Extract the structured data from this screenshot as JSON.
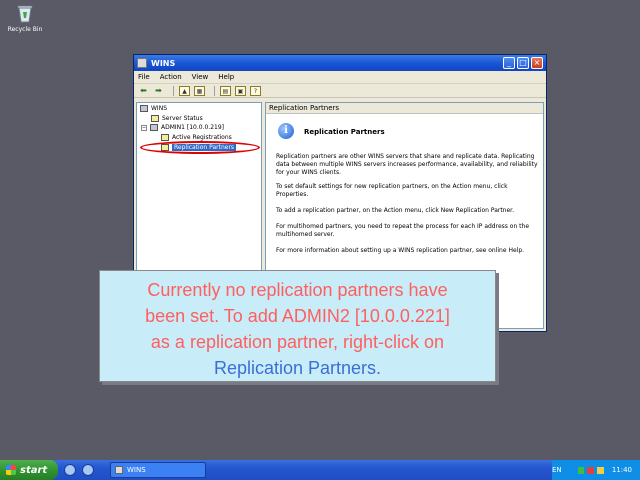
{
  "desktop": {
    "recycle_bin_label": "Recycle Bin"
  },
  "window": {
    "title": "WINS",
    "menu": [
      "File",
      "Action",
      "View",
      "Help"
    ],
    "tree": {
      "root": "WINS",
      "server_status": "Server Status",
      "server": "ADMIN1 [10.0.0.219]",
      "active_registrations": "Active Registrations",
      "replication_partners": "Replication Partners"
    },
    "content": {
      "header": "Replication Partners",
      "title": "Replication Partners",
      "paragraphs": [
        "Replication partners are other WINS servers that share and replicate data. Replicating data between multiple WINS servers increases performance, availability, and reliability for your WINS clients.",
        "To set default settings for new replication partners, on the Action menu, click Properties.",
        "To add a replication partner, on the Action menu, click New Replication Partner.",
        "For multihomed partners, you need to repeat the process for each IP address on the multihomed server.",
        "For more information about setting up a WINS replication partner, see online Help."
      ]
    }
  },
  "caption": {
    "line1": "Currently no replication partners have",
    "line2": "been set. To add ADMIN2 [10.0.0.221]",
    "line3": "as a replication partner, right-click on",
    "line4": "Replication Partners."
  },
  "taskbar": {
    "start_label": "start",
    "task_label": "WINS",
    "lang": "EN",
    "clock": "11:40"
  },
  "colors": {
    "caption_text": "#ff5f5f",
    "caption_highlight": "#3a6fd6",
    "caption_bg": "#c8ecf8",
    "annotation_ring": "#e00000"
  }
}
